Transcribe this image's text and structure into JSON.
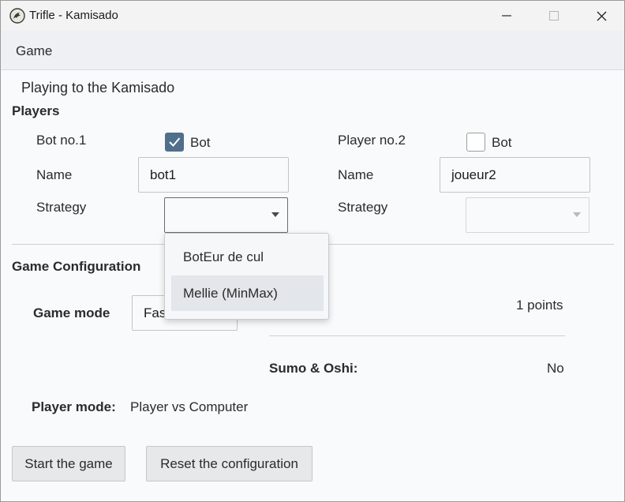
{
  "window": {
    "title": "Trifle - Kamisado"
  },
  "menu": {
    "game_label": "Game"
  },
  "header": {
    "subtitle": "Playing to the Kamisado"
  },
  "players": {
    "section_label": "Players",
    "player1": {
      "label": "Bot no.1",
      "bot_label": "Bot",
      "bot_checked": true,
      "name_label": "Name",
      "name_value": "bot1",
      "strategy_label": "Strategy",
      "strategy_value": ""
    },
    "player2": {
      "label": "Player no.2",
      "bot_label": "Bot",
      "bot_checked": false,
      "name_label": "Name",
      "name_value": "joueur2",
      "strategy_label": "Strategy",
      "strategy_value": ""
    }
  },
  "strategy_dropdown": {
    "options": [
      "BotEur de cul",
      "Mellie (MinMax)"
    ],
    "highlighted_index": 1
  },
  "config": {
    "section_label": "Game Configuration",
    "game_mode_label": "Game mode",
    "game_mode_value": "Fas",
    "points_value": "1 points",
    "sumo_label": "Sumo & Oshi:",
    "sumo_value": "No",
    "player_mode_label": "Player mode:",
    "player_mode_value": "Player vs Computer"
  },
  "actions": {
    "start_label": "Start the game",
    "reset_label": "Reset the configuration"
  },
  "colors": {
    "accent": "#4f6f8a",
    "background": "#f9fafb",
    "menubar": "#eef0f3"
  },
  "icons": {
    "app": "dragon-icon",
    "minimize": "minimize-icon",
    "maximize": "maximize-icon",
    "close": "close-icon",
    "check": "check-icon",
    "dropdown": "chevron-down-icon"
  }
}
